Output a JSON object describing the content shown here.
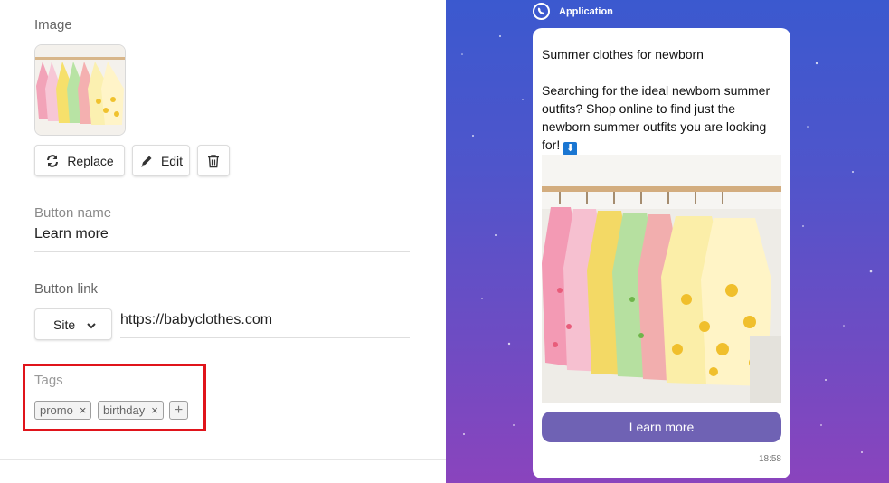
{
  "editor": {
    "image_label": "Image",
    "replace_label": "Replace",
    "edit_label": "Edit",
    "button_name_label": "Button name",
    "button_name_value": "Learn more",
    "button_link_label": "Button link",
    "link_type": "Site",
    "link_value": "https://babyclothes.com",
    "tags_label": "Tags",
    "tags": [
      "promo",
      "birthday"
    ],
    "tag_remove_glyph": "×",
    "tag_add_glyph": "+",
    "highlight_color": "#e0141b"
  },
  "preview": {
    "app_name": "Application",
    "message_title": "Summer clothes for newborn",
    "message_body": "Searching for the ideal newborn summer outfits? Shop online to find just the newborn summer outfits you are looking for!",
    "message_emoji": "⬇",
    "button_label": "Learn more",
    "time": "18:58",
    "button_color": "#6f62b4",
    "icons": {
      "app": "viber-icon",
      "emoji": "down-arrow-icon"
    }
  }
}
